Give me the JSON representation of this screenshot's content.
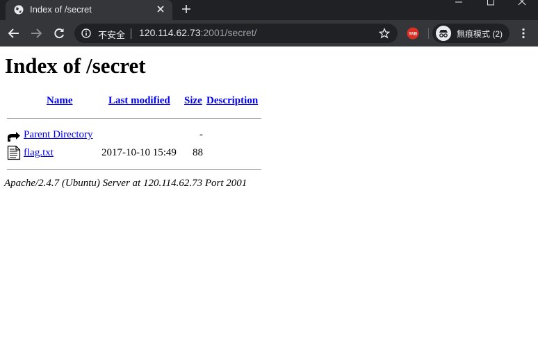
{
  "browser": {
    "tab_title": "Index of /secret",
    "security_label": "不安全",
    "url_host": "120.114.62.73",
    "url_rest": ":2001/secret/",
    "extension_badge": "YAB",
    "incognito_label": "無痕模式 (2)",
    "icons": [
      "globe-icon",
      "close-icon",
      "plus-icon",
      "minimize-icon",
      "maximize-icon",
      "window-close-icon",
      "back-arrow-icon",
      "forward-arrow-icon",
      "reload-icon",
      "info-icon",
      "star-icon",
      "incognito-icon",
      "more-vert-icon"
    ]
  },
  "page": {
    "heading": "Index of /secret",
    "columns": [
      "Name",
      "Last modified",
      "Size",
      "Description"
    ],
    "rows": [
      {
        "name": "Parent Directory",
        "modified": "",
        "size": "-",
        "description": "",
        "icon": "back-folder-icon"
      },
      {
        "name": "flag.txt",
        "modified": "2017-10-10 15:49",
        "size": "88",
        "description": "",
        "icon": "text-file-icon"
      }
    ],
    "footer": "Apache/2.4.7 (Ubuntu) Server at 120.114.62.73 Port 2001"
  },
  "colors": {
    "chrome_dark": "#202124",
    "chrome_tab": "#35363a",
    "link": "#0000ee"
  }
}
